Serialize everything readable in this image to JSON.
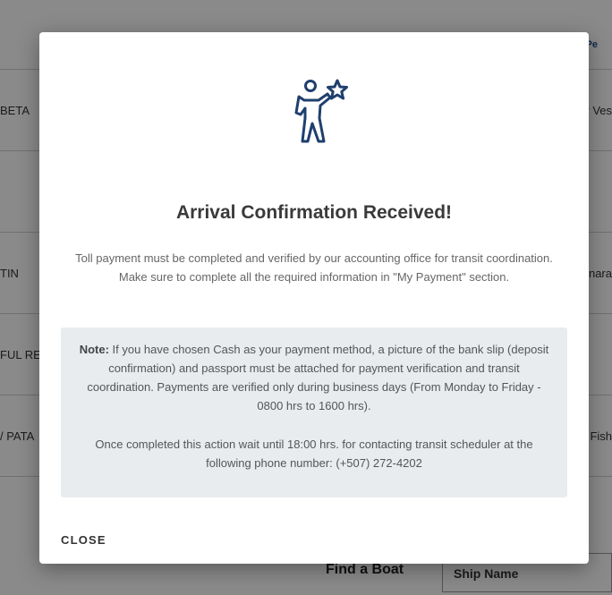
{
  "background": {
    "header_link": "Pe",
    "rows": [
      {
        "left": "BETA",
        "right": "r Ves"
      },
      {
        "left": "",
        "right": ""
      },
      {
        "left": "TIN",
        "right": "nara"
      },
      {
        "left": "FUL RE",
        "right": ""
      },
      {
        "left": "/ PATA",
        "right": "Fish"
      }
    ],
    "find_label": "Find a Boat",
    "ship_name_label": "Ship Name"
  },
  "modal": {
    "icon": "person-holding-star-icon",
    "title": "Arrival Confirmation Received!",
    "description": "Toll payment must be completed and verified by our accounting office for transit coordination. Make sure to complete all the required information in \"My Payment\" section.",
    "note": {
      "label": "Note:",
      "text": " If you have chosen Cash as your payment method, a picture of the bank slip (deposit confirmation) and passport must be attached for payment verification and transit coordination. Payments are verified only during business days (From Monday to Friday - 0800 hrs to 1600 hrs).",
      "second_paragraph": "Once completed this action wait until 18:00 hrs. for contacting transit scheduler at the following phone number: (+507) 272-4202"
    },
    "close_label": "CLOSE"
  },
  "colors": {
    "icon_blue": "#1f3f6e",
    "note_background": "#e8ecef"
  }
}
